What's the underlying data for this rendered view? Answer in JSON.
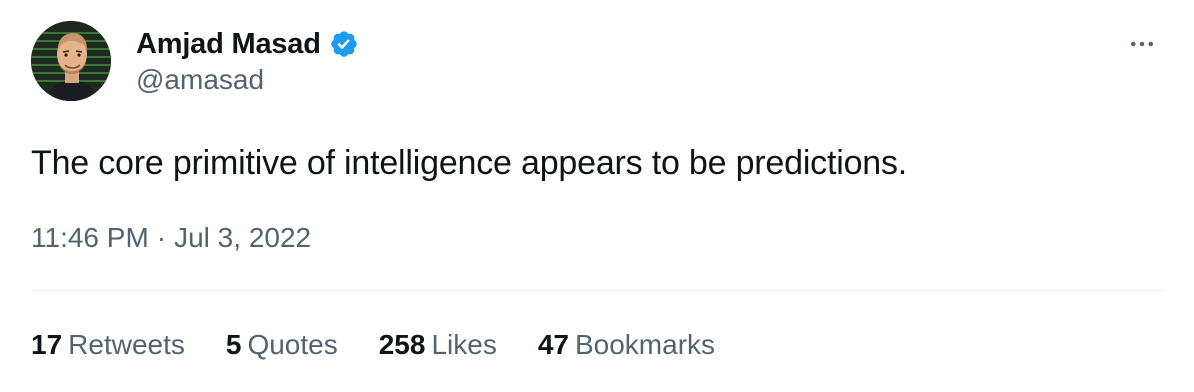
{
  "author": {
    "name": "Amjad Masad",
    "handle": "@amasad",
    "verified": true,
    "avatar_icon": "cartoon-portrait-avatar",
    "verified_icon": "verified-badge-icon",
    "verified_color": "#1d9bf0"
  },
  "more_icon": "more-options-icon",
  "tweet": {
    "text": "The core primitive of intelligence appears to be predictions.",
    "time": "11:46 PM",
    "separator": "·",
    "date": "Jul 3, 2022"
  },
  "stats": [
    {
      "count": "17",
      "label": "Retweets"
    },
    {
      "count": "5",
      "label": "Quotes"
    },
    {
      "count": "258",
      "label": "Likes"
    },
    {
      "count": "47",
      "label": "Bookmarks"
    }
  ],
  "colors": {
    "text_primary": "#0f1419",
    "text_secondary": "#536471",
    "divider": "#eff3f4",
    "accent": "#1d9bf0"
  }
}
